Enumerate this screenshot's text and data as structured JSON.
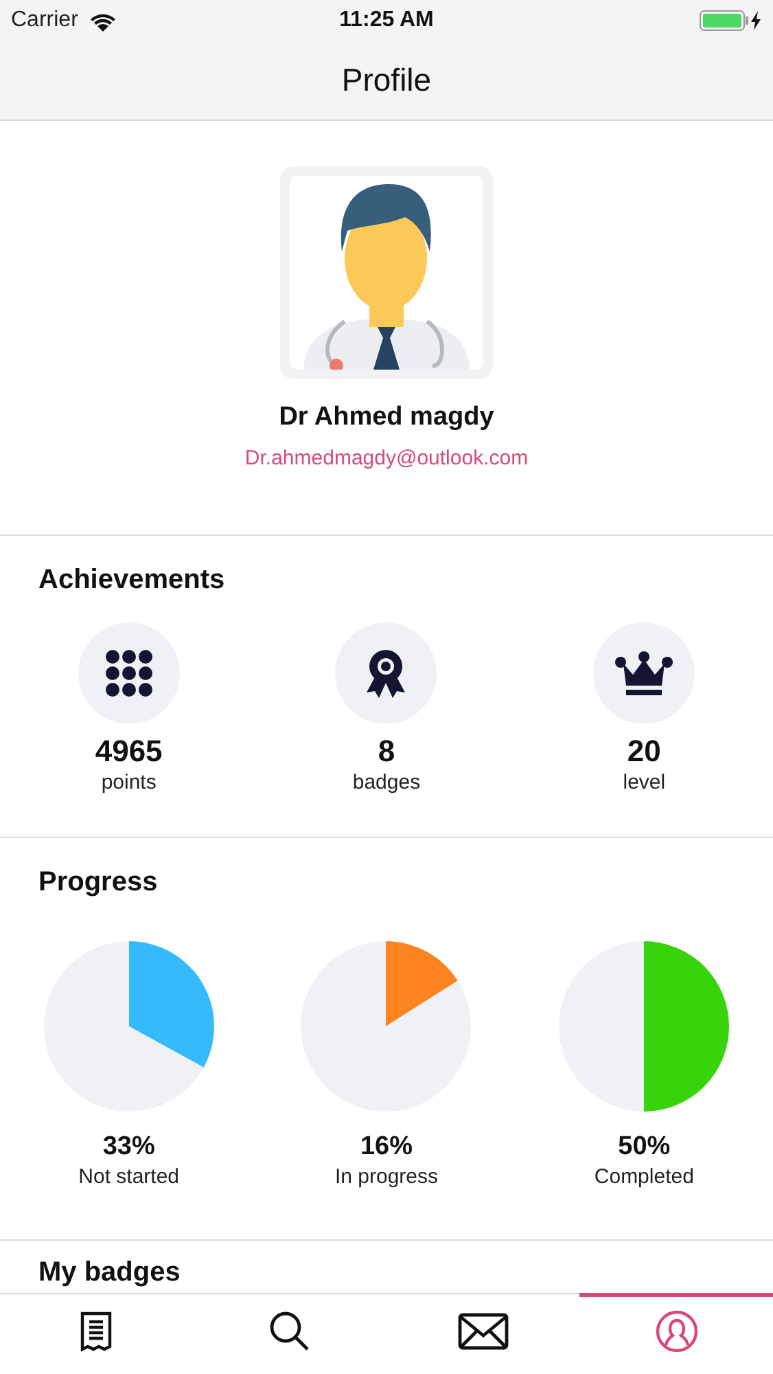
{
  "status_bar": {
    "carrier": "Carrier",
    "time": "11:25 AM"
  },
  "nav": {
    "title": "Profile"
  },
  "profile": {
    "name": "Dr Ahmed magdy",
    "email": "Dr.ahmedmagdy@outlook.com"
  },
  "achievements": {
    "title": "Achievements",
    "items": [
      {
        "kind": "points",
        "value": "4965",
        "label": "points"
      },
      {
        "kind": "badges",
        "value": "8",
        "label": "badges"
      },
      {
        "kind": "level",
        "value": "20",
        "label": "level"
      }
    ]
  },
  "progress": {
    "title": "Progress",
    "items": [
      {
        "chart_data": {
          "type": "pie",
          "values": [
            33,
            67
          ]
        },
        "color": "#36bafe",
        "percent": "33%",
        "label": "Not started"
      },
      {
        "chart_data": {
          "type": "pie",
          "values": [
            16,
            84
          ]
        },
        "color": "#fd8420",
        "percent": "16%",
        "label": "In progress"
      },
      {
        "chart_data": {
          "type": "pie",
          "values": [
            50,
            50
          ]
        },
        "color": "#37d40b",
        "percent": "50%",
        "label": "Completed"
      }
    ]
  },
  "badges": {
    "title": "My badges"
  },
  "tabs": [
    {
      "kind": "receipt",
      "selected": false
    },
    {
      "kind": "search",
      "selected": false
    },
    {
      "kind": "mail",
      "selected": false
    },
    {
      "kind": "profile",
      "selected": true
    }
  ]
}
